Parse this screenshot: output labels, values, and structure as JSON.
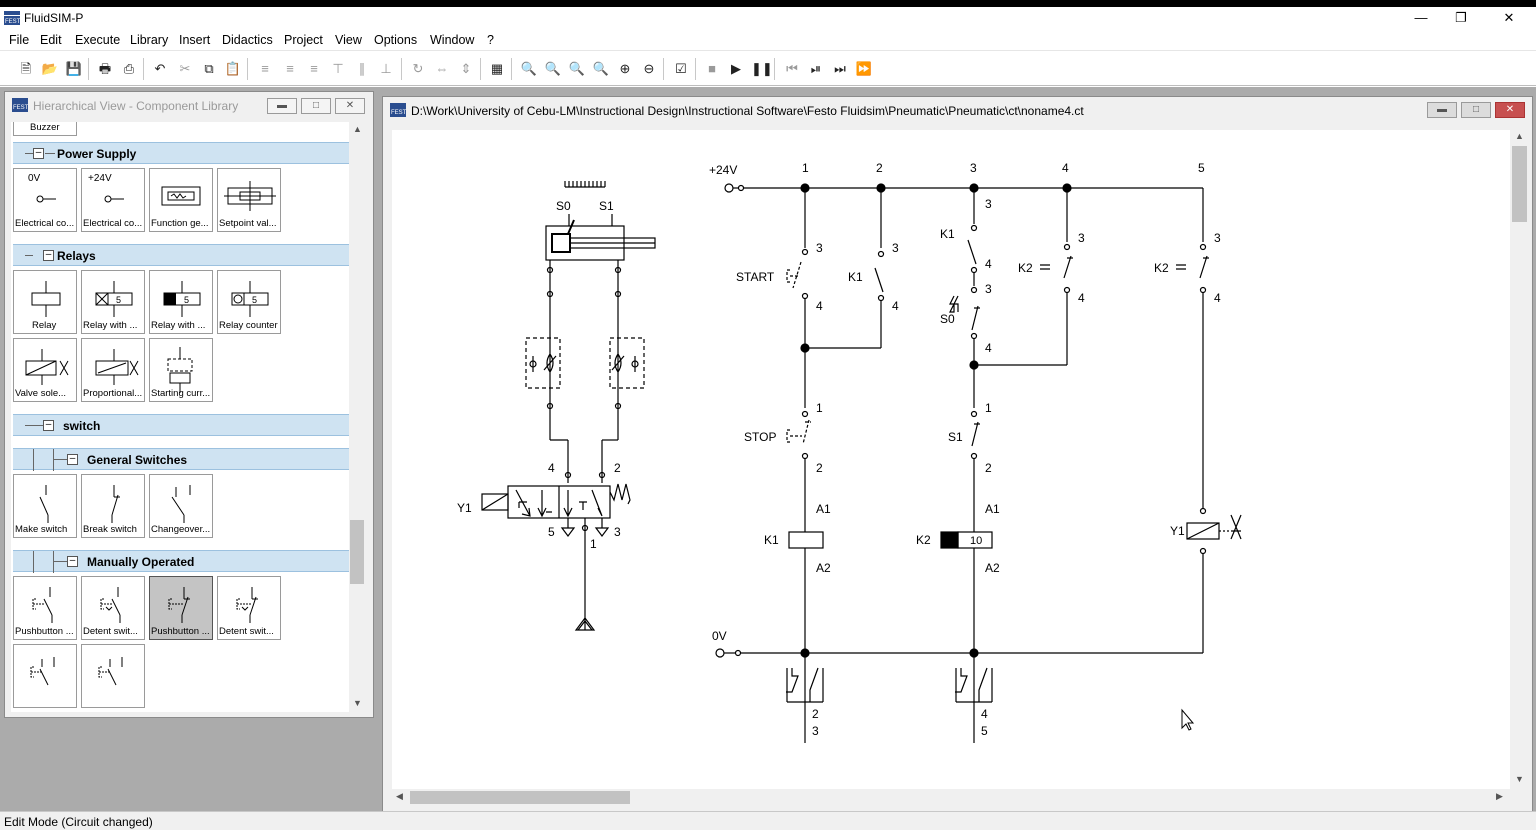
{
  "app": {
    "title": "FluidSIM-P",
    "logo_text": "FESTO"
  },
  "menu": [
    "File",
    "Edit",
    "Execute",
    "Library",
    "Insert",
    "Didactics",
    "Project",
    "View",
    "Options",
    "Window",
    "?"
  ],
  "library": {
    "title": "Hierarchical View - Component Library",
    "top_item": "Buzzer",
    "groups": {
      "power_supply": "Power Supply",
      "relays": "Relays",
      "switch": "switch",
      "general_switches": "General Switches",
      "manually_operated": "Manually Operated"
    },
    "power_tiles": [
      {
        "label": "Electrical co...",
        "top": "0V"
      },
      {
        "label": "Electrical co...",
        "top": "+24V"
      },
      {
        "label": "Function ge..."
      },
      {
        "label": "Setpoint val..."
      }
    ],
    "relay_tiles": [
      {
        "label": "Relay"
      },
      {
        "label": "Relay with ..."
      },
      {
        "label": "Relay with ..."
      },
      {
        "label": "Relay counter"
      },
      {
        "label": "Valve sole..."
      },
      {
        "label": "Proportional..."
      },
      {
        "label": "Starting curr..."
      }
    ],
    "general_tiles": [
      {
        "label": "Make switch"
      },
      {
        "label": "Break switch"
      },
      {
        "label": "Changeover..."
      }
    ],
    "manual_tiles": [
      {
        "label": "Pushbutton ..."
      },
      {
        "label": "Detent swit..."
      },
      {
        "label": "Pushbutton ..."
      },
      {
        "label": "Detent swit..."
      }
    ]
  },
  "circuit_window": {
    "title": "D:\\Work\\University of Cebu-LM\\Instructional Design\\Instructional Software\\Festo Fluidsim\\Pneumatic\\Pneumatic\\ct\\noname4.ct"
  },
  "circuit": {
    "supply_pos": "+24V",
    "supply_neg": "0V",
    "columns": [
      "1",
      "2",
      "3",
      "4",
      "5"
    ],
    "labels": {
      "start": "START",
      "stop": "STOP",
      "k1": "K1",
      "k2": "K2",
      "s0": "S0",
      "s1": "S1",
      "y1": "Y1",
      "counter_preset": "10"
    },
    "terminals": {
      "n1": "1",
      "n2": "2",
      "n3": "3",
      "n4": "4",
      "n5": "5",
      "a1": "A1",
      "a2": "A2"
    }
  },
  "status": {
    "text": "Edit Mode (Circuit changed)"
  }
}
